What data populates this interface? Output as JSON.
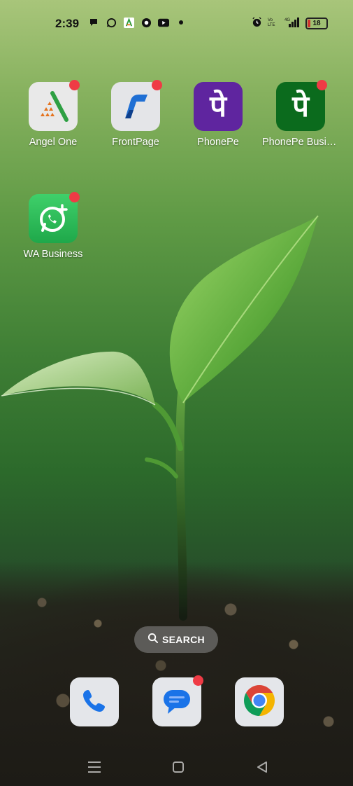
{
  "status_bar": {
    "time": "2:39",
    "left_icons": [
      "chat-bubble-icon",
      "whatsapp-icon",
      "angel-one-icon",
      "app-icon",
      "youtube-icon",
      "dot-icon"
    ],
    "right_icons": [
      "alarm-icon",
      "volte-icon",
      "4g-signal-icon"
    ],
    "battery_level": "18",
    "battery_color": "#d0322e"
  },
  "home": {
    "apps": [
      {
        "label": "Angel One",
        "has_badge": true
      },
      {
        "label": "FrontPage",
        "has_badge": true
      },
      {
        "label": "PhonePe",
        "has_badge": false
      },
      {
        "label": "PhonePe Business",
        "has_badge": true
      },
      {
        "label": "WA Business",
        "has_badge": true
      }
    ],
    "search_label": "SEARCH"
  },
  "dock": {
    "apps": [
      {
        "name": "Phone",
        "has_badge": false
      },
      {
        "name": "Messages",
        "has_badge": true
      },
      {
        "name": "Chrome",
        "has_badge": false
      }
    ]
  },
  "colors": {
    "badge": "#ef3b45",
    "phonepe_purple": "#5f259f",
    "phonepe_business_green": "#0b6b1d",
    "whatsapp_green": "#25d366"
  }
}
